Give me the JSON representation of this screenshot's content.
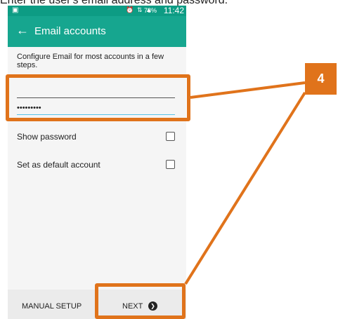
{
  "top_caption": "Enter the user's email address and password.",
  "status_bar": {
    "time": "11:42",
    "battery": "78%",
    "icons": [
      "notification-icon",
      "alarm-icon",
      "signal-icon",
      "battery-icon"
    ]
  },
  "app_bar": {
    "back_icon": "back-arrow-icon",
    "title": "Email accounts"
  },
  "form": {
    "description": "Configure Email for most accounts in a few steps.",
    "email_value": "",
    "password_value": "•••••••••",
    "show_password_label": "Show password",
    "default_account_label": "Set as default account"
  },
  "bottom_bar": {
    "manual_setup_label": "MANUAL SETUP",
    "next_label": "NEXT"
  },
  "callout": {
    "step": "4",
    "color": "#e0731b"
  },
  "colors": {
    "accent": "#16a68f",
    "status_bar": "#0d9c84",
    "highlight": "#e0731b"
  }
}
